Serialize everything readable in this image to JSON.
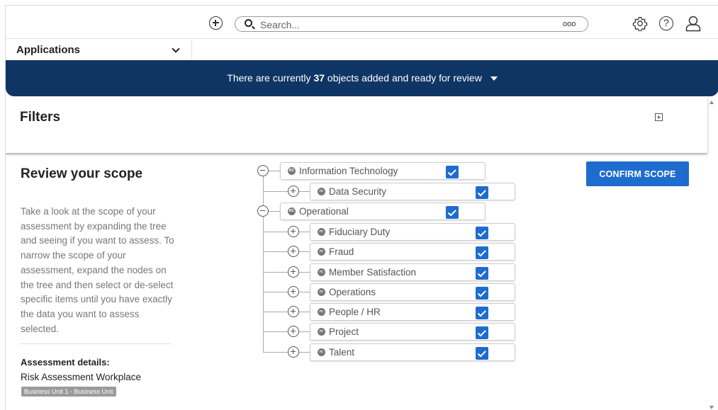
{
  "header": {
    "search_placeholder": "Search...",
    "add_icon": "plus-circle-icon",
    "more_icon": "ooo",
    "settings_icon": "gear-icon",
    "help_icon": "?",
    "profile_icon": "user-icon"
  },
  "apps": {
    "label": "Applications"
  },
  "banner": {
    "prefix": "There are currently",
    "count": "37",
    "suffix": "objects added and ready for review"
  },
  "filters": {
    "title": "Filters"
  },
  "review": {
    "title": "Review your scope",
    "description": "Take a look at the scope of your assessment by expanding the tree and seeing if you want to assess. To narrow the scope of your assessment, expand the nodes on the tree and then select or de-select specific items until you have exactly the data you want to assess selected.",
    "details_title": "Assessment details:",
    "details_name": "Risk Assessment Workplace",
    "details_badge": "Business Unit 1 - Business Unit"
  },
  "confirm_label": "CONFIRM SCOPE",
  "tree": {
    "rc_icon": "RC",
    "small_icon": "rc",
    "it": {
      "label": "Information Technology",
      "checked": true
    },
    "data_security": {
      "label": "Data Security",
      "checked": true
    },
    "operational": {
      "label": "Operational",
      "checked": true
    },
    "fiduciary": {
      "label": "Fiduciary Duty",
      "checked": true
    },
    "fraud": {
      "label": "Fraud",
      "checked": true
    },
    "member": {
      "label": "Member Satisfaction",
      "checked": true
    },
    "operations": {
      "label": "Operations",
      "checked": true
    },
    "people": {
      "label": "People / HR",
      "checked": true
    },
    "project": {
      "label": "Project",
      "checked": true
    },
    "talent": {
      "label": "Talent",
      "checked": true
    }
  },
  "colors": {
    "banner": "#0f3564",
    "accent": "#1f6ccf"
  }
}
